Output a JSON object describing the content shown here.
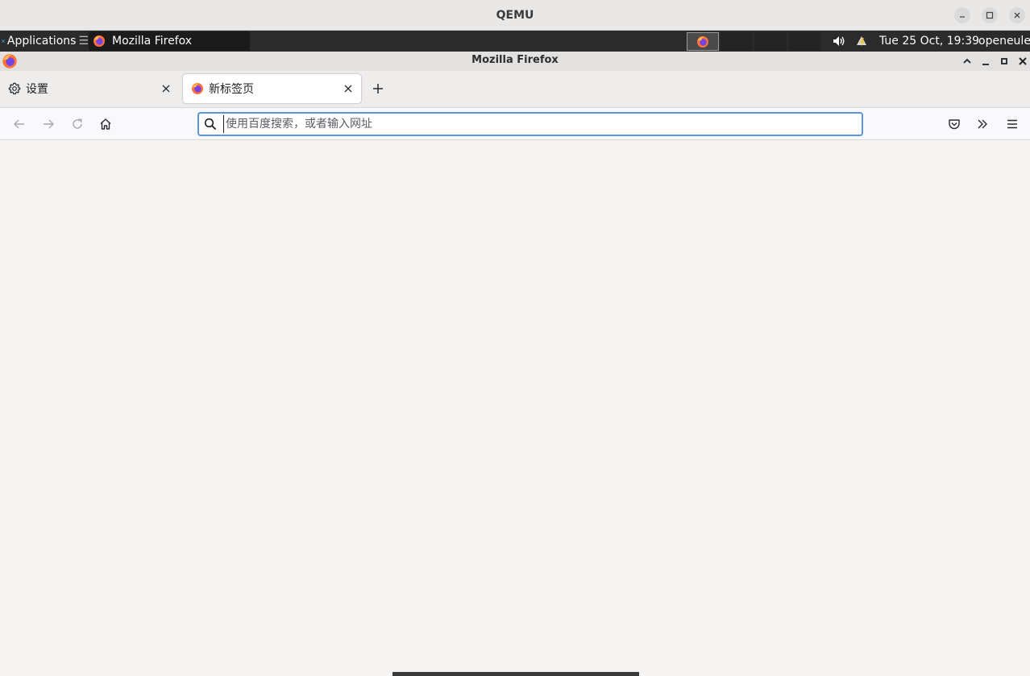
{
  "qemu": {
    "title": "QEMU"
  },
  "panel": {
    "applications_label": "Applications",
    "applications_suffix": "☰",
    "task_label": "Mozilla Firefox",
    "clock": "Tue 25 Oct, 19:39",
    "user": "openeuler"
  },
  "firefox": {
    "window_title": "Mozilla Firefox",
    "tabs": [
      {
        "label": "设置",
        "icon": "gear-icon",
        "active": false
      },
      {
        "label": "新标签页",
        "icon": "firefox-icon",
        "active": true
      }
    ],
    "urlbar": {
      "value": "",
      "placeholder": "使用百度搜索，或者输入网址"
    }
  },
  "colors": {
    "accent": "#5b94e0",
    "panel_bg": "#2b2b2b",
    "content_bg": "#f6f4f3"
  }
}
